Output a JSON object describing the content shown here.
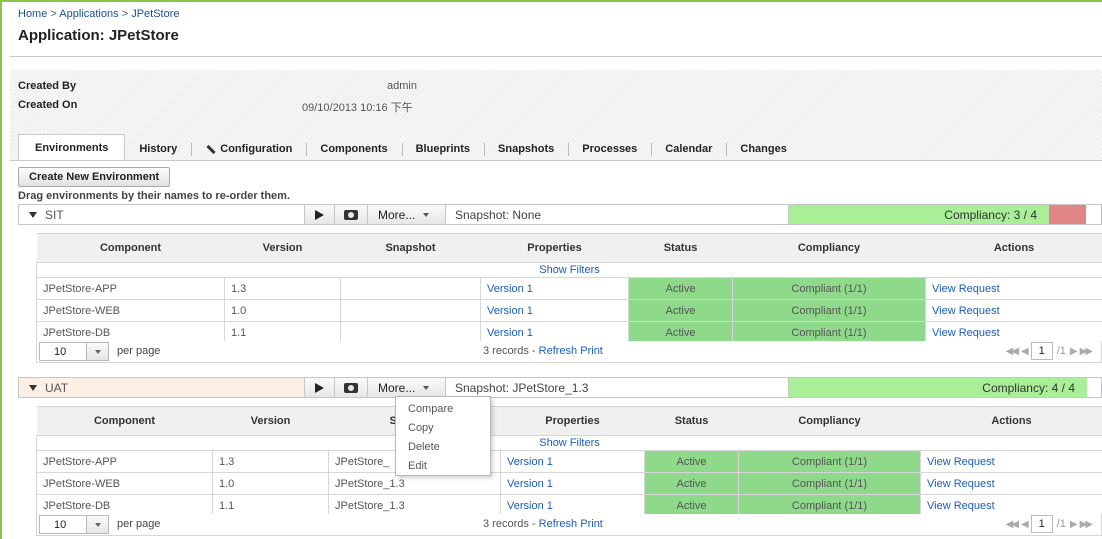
{
  "breadcrumb": {
    "home": "Home",
    "sep1": ">",
    "applications": "Applications",
    "sep2": ">",
    "current": "JPetStore"
  },
  "title": "Application: JPetStore",
  "meta": {
    "created_by_label": "Created By",
    "created_by_value": "admin",
    "created_on_label": "Created On",
    "created_on_value": "09/10/2013 10:16 下午"
  },
  "tabs": [
    "Environments",
    "History",
    "Configuration",
    "Components",
    "Blueprints",
    "Snapshots",
    "Processes",
    "Calendar",
    "Changes"
  ],
  "toolbar": {
    "create_label": "Create New Environment",
    "drag_hint": "Drag environments by their names to re-order them."
  },
  "columns": [
    "Component",
    "Version",
    "Snapshot",
    "Properties",
    "Status",
    "Compliancy",
    "Actions"
  ],
  "show_filters": "Show Filters",
  "environments": [
    {
      "name": "SIT",
      "more_label": "More...",
      "snapshot": "Snapshot: None",
      "compliancy": "Compliancy: 3 / 4",
      "rows": [
        {
          "component": "JPetStore-APP",
          "version": "1.3",
          "snapshot": "",
          "properties": "Version 1",
          "status": "Active",
          "compliancy": "Compliant (1/1)",
          "action": "View Request"
        },
        {
          "component": "JPetStore-WEB",
          "version": "1.0",
          "snapshot": "",
          "properties": "Version 1",
          "status": "Active",
          "compliancy": "Compliant (1/1)",
          "action": "View Request"
        },
        {
          "component": "JPetStore-DB",
          "version": "1.1",
          "snapshot": "",
          "properties": "Version 1",
          "status": "Active",
          "compliancy": "Compliant (1/1)",
          "action": "View Request"
        }
      ],
      "pager": {
        "page_size": "10",
        "per_page": "per page",
        "records": "3 records",
        "dash": "-",
        "refresh": "Refresh",
        "print": "Print",
        "page": "1",
        "of": "/1"
      }
    },
    {
      "name": "UAT",
      "more_label": "More...",
      "snapshot": "Snapshot: JPetStore_1.3",
      "compliancy": "Compliancy: 4 / 4",
      "rows": [
        {
          "component": "JPetStore-APP",
          "version": "1.3",
          "snapshot": "JPetStore_",
          "properties": "Version 1",
          "status": "Active",
          "compliancy": "Compliant (1/1)",
          "action": "View Request"
        },
        {
          "component": "JPetStore-WEB",
          "version": "1.0",
          "snapshot": "JPetStore_1.3",
          "properties": "Version 1",
          "status": "Active",
          "compliancy": "Compliant (1/1)",
          "action": "View Request"
        },
        {
          "component": "JPetStore-DB",
          "version": "1.1",
          "snapshot": "JPetStore_1.3",
          "properties": "Version 1",
          "status": "Active",
          "compliancy": "Compliant (1/1)",
          "action": "View Request"
        }
      ],
      "pager": {
        "page_size": "10",
        "per_page": "per page",
        "records": "3 records",
        "dash": "-",
        "refresh": "Refresh",
        "print": "Print",
        "page": "1",
        "of": "/1"
      }
    }
  ],
  "more_menu": [
    "Compare",
    "Copy",
    "Delete",
    "Edit"
  ],
  "colors": {
    "frame": "#8ac543",
    "compliant_green": "#8fd98b",
    "compliancy_bar": "#a9ef98",
    "noncompliant_red": "#e08686",
    "link": "#1a5cc4"
  }
}
